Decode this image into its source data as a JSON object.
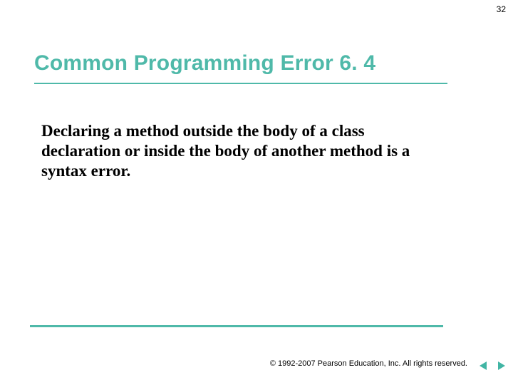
{
  "page_number": "32",
  "title": "Common Programming Error 6. 4",
  "body": "Declaring a method outside the body of a class declaration or inside the body of another method is a syntax error.",
  "copyright": "1992-2007 Pearson Education, Inc.  All rights reserved.",
  "copyright_symbol": "©",
  "nav": {
    "prev": "previous slide",
    "next": "next slide"
  }
}
